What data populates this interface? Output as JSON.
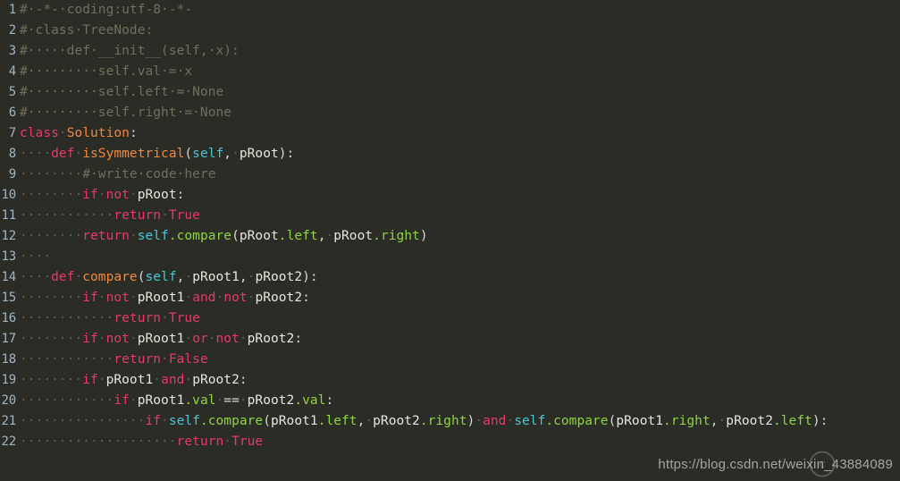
{
  "editor": {
    "background_color": "#2b2c26",
    "language": "python",
    "line_number_color": "#9fb6c4",
    "whitespace_dot": "·",
    "colors": {
      "comment": "#6f705c",
      "keyword": "#e8386a",
      "definition": "#f0883e",
      "self": "#45c8d8",
      "attribute": "#8fd63a",
      "identifier": "#e6e6de",
      "punctuation": "#d8d8d0",
      "whitespace": "#5d5e52"
    }
  },
  "lines": [
    {
      "number": "1",
      "text": "# -*- coding:utf-8 -*-",
      "tokens": [
        {
          "t": "#",
          "c": "com"
        },
        {
          "t": "·-*-·coding:utf-8·-*-",
          "c": "com"
        }
      ]
    },
    {
      "number": "2",
      "text": "# class TreeNode:",
      "tokens": [
        {
          "t": "#",
          "c": "com"
        },
        {
          "t": "·class·TreeNode:",
          "c": "com"
        }
      ]
    },
    {
      "number": "3",
      "text": "#     def __init__(self, x):",
      "tokens": [
        {
          "t": "#",
          "c": "com"
        },
        {
          "t": "·····def·__init__(self,·x):",
          "c": "com"
        }
      ]
    },
    {
      "number": "4",
      "text": "#         self.val = x",
      "tokens": [
        {
          "t": "#",
          "c": "com"
        },
        {
          "t": "·········self.val·=·x",
          "c": "com"
        }
      ]
    },
    {
      "number": "5",
      "text": "#         self.left = None",
      "tokens": [
        {
          "t": "#",
          "c": "com"
        },
        {
          "t": "·········self.left·=·None",
          "c": "com"
        }
      ]
    },
    {
      "number": "6",
      "text": "#         self.right = None",
      "tokens": [
        {
          "t": "#",
          "c": "com"
        },
        {
          "t": "·········self.right·=·None",
          "c": "com"
        }
      ]
    },
    {
      "number": "7",
      "text": "class Solution:",
      "tokens": [
        {
          "t": "class",
          "c": "kw"
        },
        {
          "t": "·",
          "c": "ws"
        },
        {
          "t": "Solution",
          "c": "def"
        },
        {
          "t": ":",
          "c": "punc"
        }
      ]
    },
    {
      "number": "8",
      "text": "    def isSymmetrical(self, pRoot):",
      "tokens": [
        {
          "t": "····",
          "c": "ws"
        },
        {
          "t": "def",
          "c": "kw"
        },
        {
          "t": "·",
          "c": "ws"
        },
        {
          "t": "isSymmetrical",
          "c": "def"
        },
        {
          "t": "(",
          "c": "punc"
        },
        {
          "t": "self",
          "c": "self"
        },
        {
          "t": ",",
          "c": "punc"
        },
        {
          "t": "·",
          "c": "ws"
        },
        {
          "t": "pRoot",
          "c": "id"
        },
        {
          "t": "):",
          "c": "punc"
        }
      ]
    },
    {
      "number": "9",
      "text": "        # write code here",
      "tokens": [
        {
          "t": "········",
          "c": "ws"
        },
        {
          "t": "#",
          "c": "com"
        },
        {
          "t": "·write·code·here",
          "c": "com"
        }
      ]
    },
    {
      "number": "10",
      "text": "        if not pRoot:",
      "tokens": [
        {
          "t": "········",
          "c": "ws"
        },
        {
          "t": "if",
          "c": "kw"
        },
        {
          "t": "·",
          "c": "ws"
        },
        {
          "t": "not",
          "c": "kw"
        },
        {
          "t": "·",
          "c": "ws"
        },
        {
          "t": "pRoot",
          "c": "id"
        },
        {
          "t": ":",
          "c": "punc"
        }
      ]
    },
    {
      "number": "11",
      "text": "            return True",
      "tokens": [
        {
          "t": "············",
          "c": "ws"
        },
        {
          "t": "return",
          "c": "kw"
        },
        {
          "t": "·",
          "c": "ws"
        },
        {
          "t": "True",
          "c": "kw"
        }
      ]
    },
    {
      "number": "12",
      "text": "        return self.compare(pRoot.left, pRoot.right)",
      "tokens": [
        {
          "t": "········",
          "c": "ws"
        },
        {
          "t": "return",
          "c": "kw"
        },
        {
          "t": "·",
          "c": "ws"
        },
        {
          "t": "self",
          "c": "self"
        },
        {
          "t": ".",
          "c": "attr"
        },
        {
          "t": "compare",
          "c": "attr"
        },
        {
          "t": "(",
          "c": "punc"
        },
        {
          "t": "pRoot",
          "c": "id"
        },
        {
          "t": ".",
          "c": "attr"
        },
        {
          "t": "left",
          "c": "attr"
        },
        {
          "t": ",",
          "c": "punc"
        },
        {
          "t": "·",
          "c": "ws"
        },
        {
          "t": "pRoot",
          "c": "id"
        },
        {
          "t": ".",
          "c": "attr"
        },
        {
          "t": "right",
          "c": "attr"
        },
        {
          "t": ")",
          "c": "punc"
        }
      ]
    },
    {
      "number": "13",
      "text": "    ",
      "tokens": [
        {
          "t": "····",
          "c": "ws"
        }
      ]
    },
    {
      "number": "14",
      "text": "    def compare(self, pRoot1, pRoot2):",
      "tokens": [
        {
          "t": "····",
          "c": "ws"
        },
        {
          "t": "def",
          "c": "kw"
        },
        {
          "t": "·",
          "c": "ws"
        },
        {
          "t": "compare",
          "c": "def"
        },
        {
          "t": "(",
          "c": "punc"
        },
        {
          "t": "self",
          "c": "self"
        },
        {
          "t": ",",
          "c": "punc"
        },
        {
          "t": "·",
          "c": "ws"
        },
        {
          "t": "pRoot1",
          "c": "id"
        },
        {
          "t": ",",
          "c": "punc"
        },
        {
          "t": "·",
          "c": "ws"
        },
        {
          "t": "pRoot2",
          "c": "id"
        },
        {
          "t": "):",
          "c": "punc"
        }
      ]
    },
    {
      "number": "15",
      "text": "        if not pRoot1 and not pRoot2:",
      "tokens": [
        {
          "t": "········",
          "c": "ws"
        },
        {
          "t": "if",
          "c": "kw"
        },
        {
          "t": "·",
          "c": "ws"
        },
        {
          "t": "not",
          "c": "kw"
        },
        {
          "t": "·",
          "c": "ws"
        },
        {
          "t": "pRoot1",
          "c": "id"
        },
        {
          "t": "·",
          "c": "ws"
        },
        {
          "t": "and",
          "c": "kw"
        },
        {
          "t": "·",
          "c": "ws"
        },
        {
          "t": "not",
          "c": "kw"
        },
        {
          "t": "·",
          "c": "ws"
        },
        {
          "t": "pRoot2",
          "c": "id"
        },
        {
          "t": ":",
          "c": "punc"
        }
      ]
    },
    {
      "number": "16",
      "text": "            return True",
      "tokens": [
        {
          "t": "············",
          "c": "ws"
        },
        {
          "t": "return",
          "c": "kw"
        },
        {
          "t": "·",
          "c": "ws"
        },
        {
          "t": "True",
          "c": "kw"
        }
      ]
    },
    {
      "number": "17",
      "text": "        if not pRoot1 or not pRoot2:",
      "tokens": [
        {
          "t": "········",
          "c": "ws"
        },
        {
          "t": "if",
          "c": "kw"
        },
        {
          "t": "·",
          "c": "ws"
        },
        {
          "t": "not",
          "c": "kw"
        },
        {
          "t": "·",
          "c": "ws"
        },
        {
          "t": "pRoot1",
          "c": "id"
        },
        {
          "t": "·",
          "c": "ws"
        },
        {
          "t": "or",
          "c": "kw"
        },
        {
          "t": "·",
          "c": "ws"
        },
        {
          "t": "not",
          "c": "kw"
        },
        {
          "t": "·",
          "c": "ws"
        },
        {
          "t": "pRoot2",
          "c": "id"
        },
        {
          "t": ":",
          "c": "punc"
        }
      ]
    },
    {
      "number": "18",
      "text": "            return False",
      "tokens": [
        {
          "t": "············",
          "c": "ws"
        },
        {
          "t": "return",
          "c": "kw"
        },
        {
          "t": "·",
          "c": "ws"
        },
        {
          "t": "False",
          "c": "kw"
        }
      ]
    },
    {
      "number": "19",
      "text": "        if pRoot1 and pRoot2:",
      "tokens": [
        {
          "t": "········",
          "c": "ws"
        },
        {
          "t": "if",
          "c": "kw"
        },
        {
          "t": "·",
          "c": "ws"
        },
        {
          "t": "pRoot1",
          "c": "id"
        },
        {
          "t": "·",
          "c": "ws"
        },
        {
          "t": "and",
          "c": "kw"
        },
        {
          "t": "·",
          "c": "ws"
        },
        {
          "t": "pRoot2",
          "c": "id"
        },
        {
          "t": ":",
          "c": "punc"
        }
      ]
    },
    {
      "number": "20",
      "text": "            if pRoot1.val == pRoot2.val:",
      "tokens": [
        {
          "t": "············",
          "c": "ws"
        },
        {
          "t": "if",
          "c": "kw"
        },
        {
          "t": "·",
          "c": "ws"
        },
        {
          "t": "pRoot1",
          "c": "id"
        },
        {
          "t": ".",
          "c": "attr"
        },
        {
          "t": "val",
          "c": "attr"
        },
        {
          "t": "·",
          "c": "ws"
        },
        {
          "t": "==",
          "c": "punc"
        },
        {
          "t": "·",
          "c": "ws"
        },
        {
          "t": "pRoot2",
          "c": "id"
        },
        {
          "t": ".",
          "c": "attr"
        },
        {
          "t": "val",
          "c": "attr"
        },
        {
          "t": ":",
          "c": "punc"
        }
      ]
    },
    {
      "number": "21",
      "text": "                if self.compare(pRoot1.left, pRoot2.right) and self.compare(pRoot1.right, pRoot2.left):",
      "tokens": [
        {
          "t": "················",
          "c": "ws"
        },
        {
          "t": "if",
          "c": "kw"
        },
        {
          "t": "·",
          "c": "ws"
        },
        {
          "t": "self",
          "c": "self"
        },
        {
          "t": ".",
          "c": "attr"
        },
        {
          "t": "compare",
          "c": "attr"
        },
        {
          "t": "(",
          "c": "punc"
        },
        {
          "t": "pRoot1",
          "c": "id"
        },
        {
          "t": ".",
          "c": "attr"
        },
        {
          "t": "left",
          "c": "attr"
        },
        {
          "t": ",",
          "c": "punc"
        },
        {
          "t": "·",
          "c": "ws"
        },
        {
          "t": "pRoot2",
          "c": "id"
        },
        {
          "t": ".",
          "c": "attr"
        },
        {
          "t": "right",
          "c": "attr"
        },
        {
          "t": ")",
          "c": "punc"
        },
        {
          "t": "·",
          "c": "ws"
        },
        {
          "t": "and",
          "c": "kw"
        },
        {
          "t": "·",
          "c": "ws"
        },
        {
          "t": "self",
          "c": "self"
        },
        {
          "t": ".",
          "c": "attr"
        },
        {
          "t": "compare",
          "c": "attr"
        },
        {
          "t": "(",
          "c": "punc"
        },
        {
          "t": "pRoot1",
          "c": "id"
        },
        {
          "t": ".",
          "c": "attr"
        },
        {
          "t": "right",
          "c": "attr"
        },
        {
          "t": ",",
          "c": "punc"
        },
        {
          "t": "·",
          "c": "ws"
        },
        {
          "t": "pRoot2",
          "c": "id"
        },
        {
          "t": ".",
          "c": "attr"
        },
        {
          "t": "left",
          "c": "attr"
        },
        {
          "t": "):",
          "c": "punc"
        }
      ]
    },
    {
      "number": "22",
      "text": "                    return True",
      "tokens": [
        {
          "t": "····················",
          "c": "ws"
        },
        {
          "t": "return",
          "c": "kw"
        },
        {
          "t": "·",
          "c": "ws"
        },
        {
          "t": "True",
          "c": "kw"
        }
      ]
    }
  ],
  "watermark": {
    "url": "https://blog.csdn.net/weixin_43884089",
    "logo_name": "csdn-logo"
  }
}
